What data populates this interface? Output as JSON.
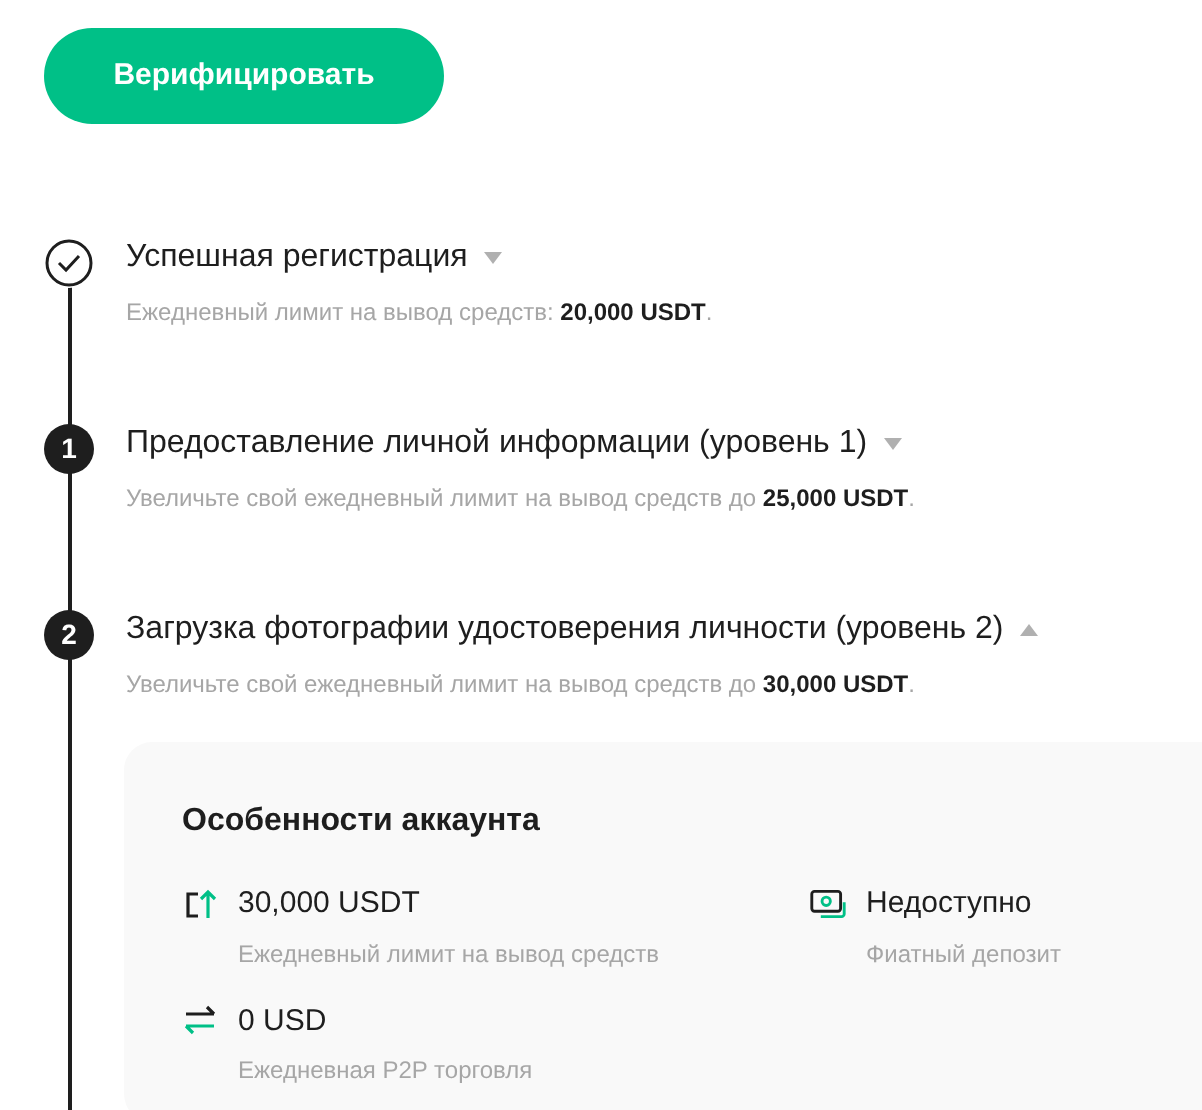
{
  "verify_button": "Верифицировать",
  "steps": [
    {
      "kind": "done",
      "title": "Успешная регистрация",
      "subtitle": "Ежедневный лимит на вывод средств: **20,000 USDT**.",
      "expanded": false
    },
    {
      "kind": "numbered",
      "number": "1",
      "title": "Предоставление личной информации (уровень 1)",
      "subtitle": "Увеличьте свой ежедневный лимит на вывод средств до **25,000 USDT**.",
      "expanded": false
    },
    {
      "kind": "numbered",
      "number": "2",
      "title": "Загрузка фотографии удостоверения личности (уровень 2)",
      "subtitle": "Увеличьте свой ежедневный лимит на вывод средств до **30,000 USDT**.",
      "expanded": true
    }
  ],
  "features_card": {
    "title": "Особенности аккаунта",
    "items": [
      {
        "kind": "withdraw",
        "value": "30,000 USDT",
        "label": "Ежедневный лимит на вывод средств"
      },
      {
        "kind": "fiat",
        "value": "Недоступно",
        "label": "Фиатный депозит"
      },
      {
        "kind": "p2p",
        "value": "0 USD",
        "label": "Ежедневная P2P торговля"
      }
    ]
  }
}
